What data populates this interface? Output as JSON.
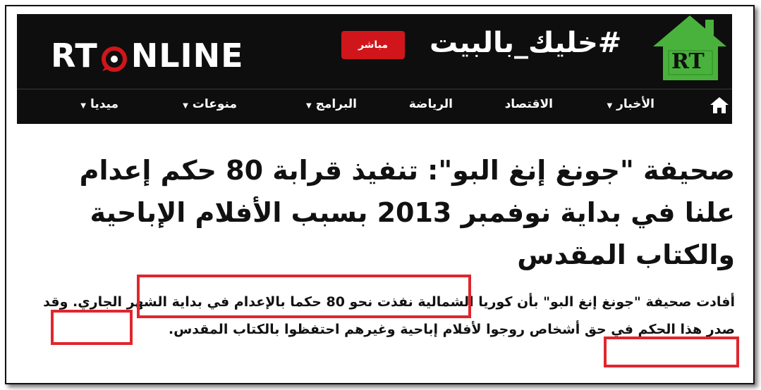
{
  "header": {
    "logo": {
      "prefix": "RT",
      "suffix": "NLINE"
    },
    "live_label": "مباشر",
    "hashtag": "#خليك_بالبيت",
    "house_badge": "RT",
    "accent_color": "#d0161b",
    "house_color": "#49b23c"
  },
  "nav": {
    "items": [
      {
        "label": "الأخبار",
        "dropdown": true
      },
      {
        "label": "الاقتصاد",
        "dropdown": false
      },
      {
        "label": "الرياضة",
        "dropdown": false
      },
      {
        "label": "البرامج",
        "dropdown": true
      },
      {
        "label": "منوعات",
        "dropdown": true
      },
      {
        "label": "ميديا",
        "dropdown": true
      }
    ]
  },
  "article": {
    "title": "صحيفة \"جونغ إنغ البو\": تنفيذ قرابة 80 حكم إعدام علنا في بداية نوفمبر 2013 بسبب الأفلام الإباحية والكتاب المقدس",
    "body": "أفادت صحيفة \"جونغ إنغ البو\" بأن كوريا الشمالية نفذت نحو 80 حكما بالإعدام في بداية الشهر الجاري. وقد صدر هذا الحكم في حق أشخاص روجوا لأفلام إباحية وغيرهم احتفظوا بالكتاب المقدس."
  },
  "highlight_color": "#e0262d"
}
